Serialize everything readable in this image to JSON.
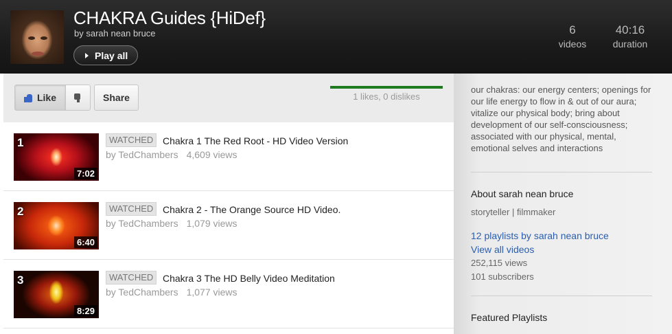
{
  "header": {
    "title": "CHAKRA Guides {HiDef}",
    "byline": "by sarah nean bruce",
    "play_all": "Play all",
    "videos_count": "6",
    "videos_label": "videos",
    "duration_value": "40:16",
    "duration_label": "duration"
  },
  "actions": {
    "like": "Like",
    "share": "Share",
    "ratio_text": "1 likes, 0 dislikes",
    "like_ratio": 1.0
  },
  "videos": [
    {
      "index": "1",
      "duration": "7:02",
      "status": "WATCHED",
      "title": "Chakra 1 The Red Root - HD Video Version",
      "author": "by TedChambers",
      "views": "4,609 views"
    },
    {
      "index": "2",
      "duration": "6:40",
      "status": "WATCHED",
      "title": "Chakra 2 - The Orange Source HD Video.",
      "author": "by TedChambers",
      "views": "1,079 views"
    },
    {
      "index": "3",
      "duration": "8:29",
      "status": "WATCHED",
      "title": "Chakra 3 The HD Belly Video Meditation",
      "author": "by TedChambers",
      "views": "1,077 views"
    }
  ],
  "sidebar": {
    "description": "our chakras: our energy centers; openings for our life energy to flow in & out of our aura; vitalize our physical body; bring about development of our self-consciousness; associated with our physical, mental, emotional selves and interactions",
    "about_title": "About sarah nean bruce",
    "about_subtitle": "storyteller | filmmaker",
    "playlists_link": "12 playlists by sarah nean bruce",
    "view_all_link": "View all videos",
    "views": "252,115 views",
    "subscribers": "101 subscribers",
    "featured_title": "Featured Playlists"
  },
  "colors": {
    "link": "#2a5db0",
    "like_bar": "#1e7a1e",
    "like_icon": "#3a66c5"
  }
}
